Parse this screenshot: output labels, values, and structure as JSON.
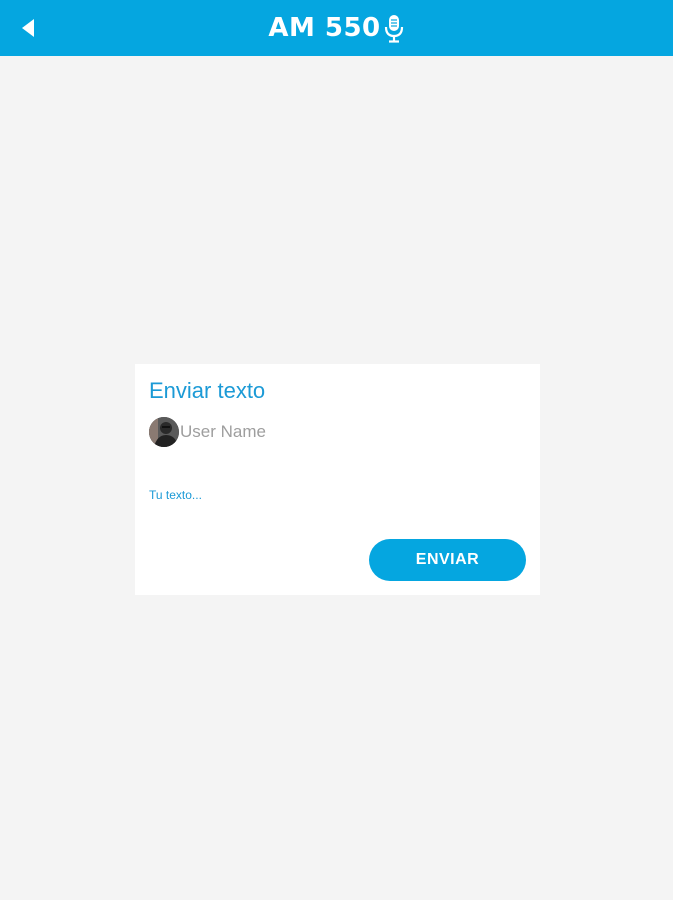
{
  "header": {
    "back_icon": "back-arrow-icon",
    "logo_text": "AM 550",
    "logo_icon": "microphone-icon",
    "background_color": "#05a6e0"
  },
  "dialog": {
    "title": "Enviar texto",
    "user_name": "User Name",
    "avatar_icon": "user-avatar",
    "text_placeholder": "Tu texto...",
    "send_label": "ENVIAR",
    "accent_color": "#1b9ad6"
  }
}
